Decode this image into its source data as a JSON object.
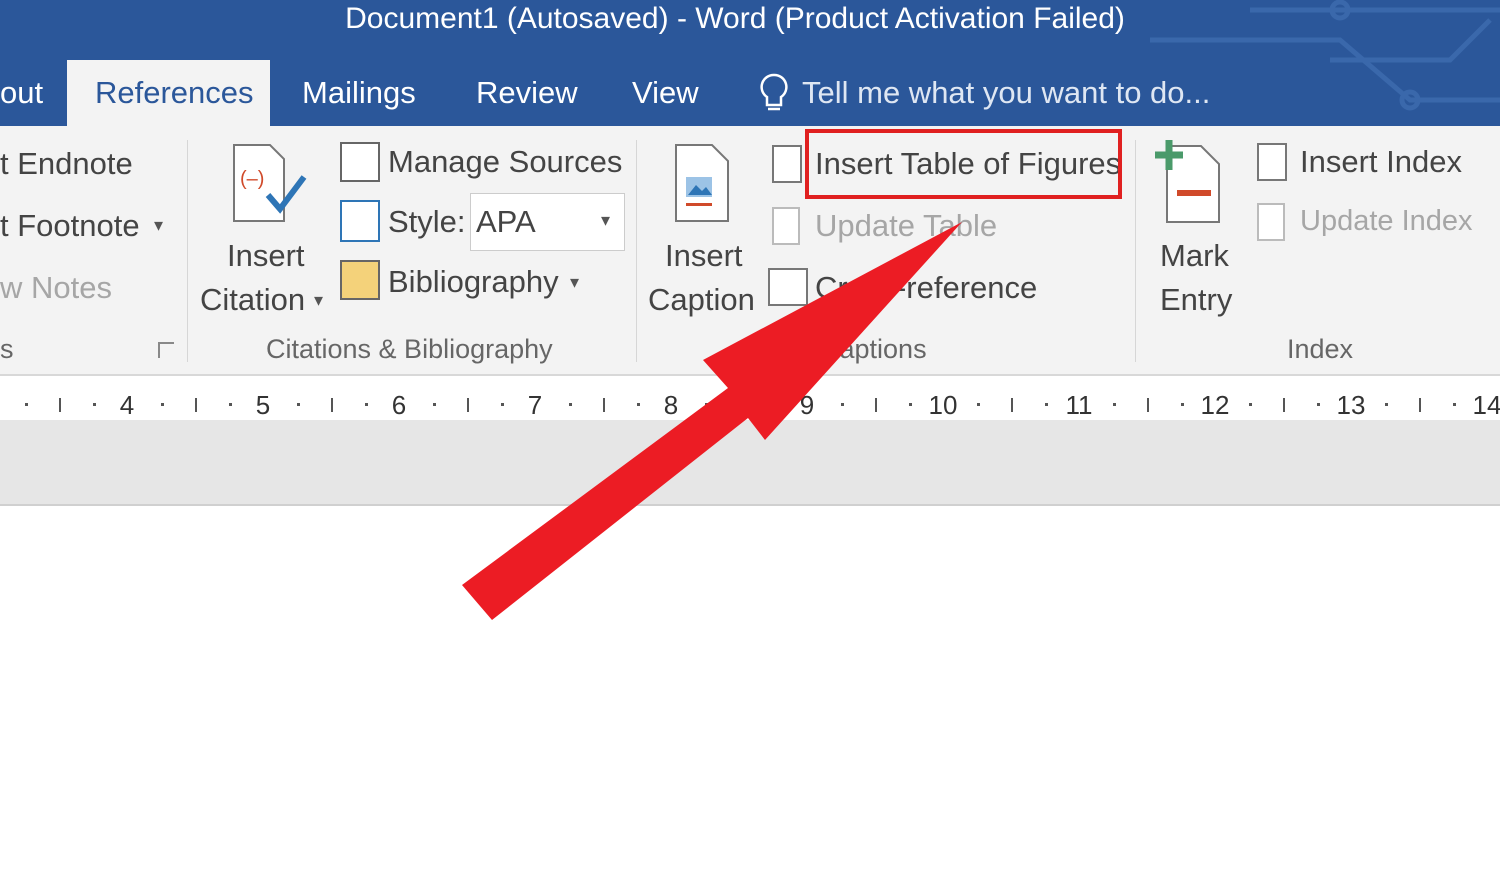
{
  "window": {
    "title": "Document1 (Autosaved) - Word (Product Activation Failed)"
  },
  "tabs": [
    {
      "label": "out"
    },
    {
      "label": "References",
      "active": true
    },
    {
      "label": "Mailings"
    },
    {
      "label": "Review"
    },
    {
      "label": "View"
    }
  ],
  "tell_me": {
    "placeholder": "Tell me what you want to do..."
  },
  "footnotes": {
    "insert_endnote": "t Endnote",
    "next_footnote": "t Footnote",
    "show_notes": "w Notes",
    "group": "s"
  },
  "citations": {
    "insert_citation_1": "Insert",
    "insert_citation_2": "Citation",
    "manage_sources": "Manage Sources",
    "style_label": "Style:",
    "style_value": "APA",
    "bibliography": "Bibliography",
    "group": "Citations & Bibliography"
  },
  "captions": {
    "insert_caption_1": "Insert",
    "insert_caption_2": "Caption",
    "insert_table_of_figures": "Insert Table of Figures",
    "update_table": "Update Table",
    "cross_reference": "Cross-reference",
    "group": "Captions"
  },
  "index": {
    "mark_entry_1": "Mark",
    "mark_entry_2": "Entry",
    "insert_index": "Insert Index",
    "update_index": "Update Index",
    "group": "Index"
  },
  "ruler": {
    "numbers": [
      "4",
      "5",
      "6",
      "7",
      "8",
      "9",
      "10",
      "11",
      "12",
      "13",
      "14"
    ]
  },
  "annotation": {
    "highlight_color": "#e02020",
    "arrow_color": "#ec1c24"
  },
  "colors": {
    "brand": "#2b579a",
    "ribbon": "#f3f3f3"
  }
}
